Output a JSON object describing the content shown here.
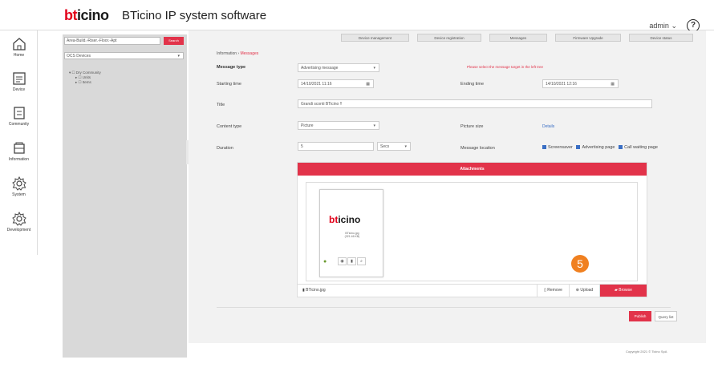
{
  "header": {
    "logo_b": "bt",
    "logo_rest": "icino",
    "title": "BTicino IP system software",
    "user": "admin",
    "user_chevron": "⌄",
    "help": "?"
  },
  "nav": [
    {
      "label": "Home",
      "icon": "home-icon"
    },
    {
      "label": "Device",
      "icon": "device-icon"
    },
    {
      "label": "Community",
      "icon": "community-icon"
    },
    {
      "label": "Information",
      "icon": "information-icon"
    },
    {
      "label": "System",
      "icon": "system-gear-icon"
    },
    {
      "label": "Development",
      "icon": "development-gear-icon"
    }
  ],
  "tree": {
    "search_placeholder": "Area-Build.-Riser.-Floor.-Apt",
    "search_button": "Search",
    "filter": "OCS Devices",
    "nodes": [
      "Dry Community",
      "Units",
      "Items"
    ]
  },
  "tabs": [
    {
      "label": "Device management"
    },
    {
      "label": "Device registration"
    },
    {
      "label": "Messages"
    },
    {
      "label": "Firmware Upgrade"
    },
    {
      "label": "Device status"
    }
  ],
  "breadcrumb": {
    "root": "Information",
    "current": "Messages"
  },
  "form": {
    "message_type_label": "Message type",
    "message_type_value": "Advertising message",
    "starting_time_label": "Starting time",
    "starting_time_value": "14/10/2021 11:16",
    "ending_time_label": "Ending time",
    "ending_time_value": "14/10/2021 12:16",
    "title_label": "Title",
    "title_value": "Grandi sconti BTicino !!",
    "content_type_label": "Content type",
    "content_type_value": "Picture",
    "picture_size_label": "Picture size",
    "picture_size_link": "Details",
    "duration_label": "Duration",
    "duration_value": "5",
    "duration_unit": "Secs",
    "location_label": "Message location",
    "locations": [
      "Screensaver",
      "Advertising page",
      "Call waiting page"
    ],
    "warning": "Please select the message target in the left tree"
  },
  "attachments": {
    "header": "Attachments",
    "thumb_name": "BTicino.jpg",
    "thumb_size": "(321.46 KB)",
    "file_name": "BTicino.jpg",
    "remove": "Remove",
    "upload": "Upload",
    "browse": "Browse"
  },
  "step_badge": "5",
  "buttons": {
    "publish": "Publish",
    "query": "Query list"
  },
  "footer": "Copyright 2021 © Ticino SpA"
}
